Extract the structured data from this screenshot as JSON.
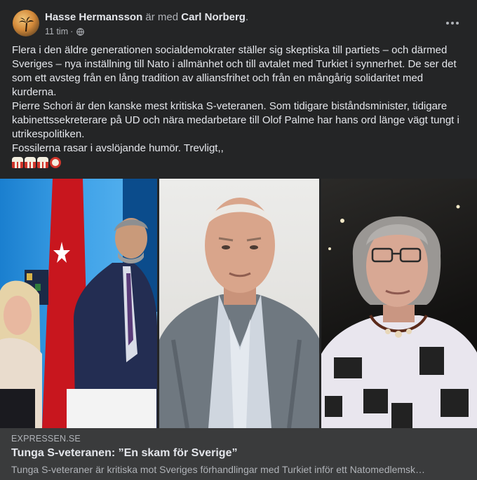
{
  "post": {
    "author": "Hasse Hermansson",
    "with_text": "är med",
    "tagged": "Carl Norberg",
    "tagged_suffix": ".",
    "timestamp": "11 tim",
    "separator": "·",
    "privacy_icon": "globe-icon",
    "menu_icon": "more-options-icon",
    "paragraphs": [
      "Flera i den äldre generationen socialdemokrater ställer sig skeptiska till partiets – och därmed Sveriges – nya inställning till Nato i allmänhet och till avtalet med Turkiet i synnerhet. De ser det som ett avsteg från en lång tradition av alliansfrihet och från en mångårig solidaritet med kurderna.",
      "Pierre Schori är den kanske mest kritiska S-veteranen. Som tidigare biståndsminister, tidigare kabinettssekreterare på UD och nära medarbetare till Olof Palme har hans ord länge vägt tungt i utrikespolitiken.",
      "Fossilerna rasar i avslöjande humör. Trevligt,,"
    ],
    "emojis": [
      "popcorn-icon",
      "popcorn-icon",
      "popcorn-icon",
      "alarm-clock-icon"
    ]
  },
  "link": {
    "domain": "EXPRESSEN.SE",
    "title": "Tunga S-veteranen: ”En skam för Sverige”",
    "description": "Tunga S-veteraner är kritiska mot Sveriges förhandlingar med Turkiet inför ett Natomedlemsk…"
  },
  "colors": {
    "card_bg": "#242526",
    "link_bg": "#3a3b3c",
    "primary_text": "#e4e6eb",
    "secondary_text": "#b0b3b8"
  }
}
